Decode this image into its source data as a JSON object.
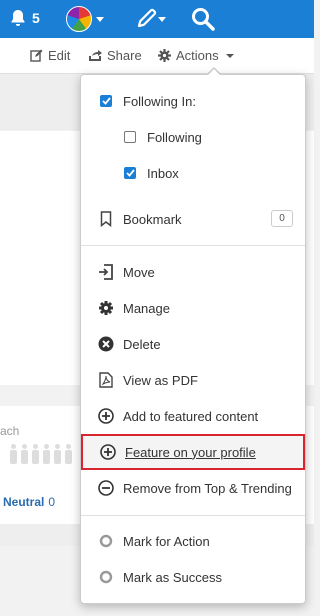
{
  "topbar": {
    "notification_count": "5",
    "bell_icon": "bell-icon",
    "avatar_icon": "avatar-pie-icon",
    "compose_icon": "pencil-icon",
    "search_icon": "search-icon",
    "bg_color": "#1b7fd6"
  },
  "actionbar": {
    "edit_label": "Edit",
    "share_label": "Share",
    "actions_label": "Actions"
  },
  "background": {
    "reach_label": "ach",
    "neutral_label": "Neutral",
    "neutral_count": "0"
  },
  "menu": {
    "following_in": "Following In:",
    "following": "Following",
    "inbox": "Inbox",
    "bookmark": "Bookmark",
    "bookmark_count": "0",
    "move": "Move",
    "manage": "Manage",
    "delete": "Delete",
    "view_as_pdf": "View as PDF",
    "add_featured": "Add to featured content",
    "feature_profile": "Feature on your profile",
    "remove_top": "Remove from Top & Trending",
    "mark_action": "Mark for Action",
    "mark_success": "Mark as Success",
    "checked": {
      "following_in": true,
      "following": false,
      "inbox": true
    },
    "highlight_color": "#d9262e"
  }
}
